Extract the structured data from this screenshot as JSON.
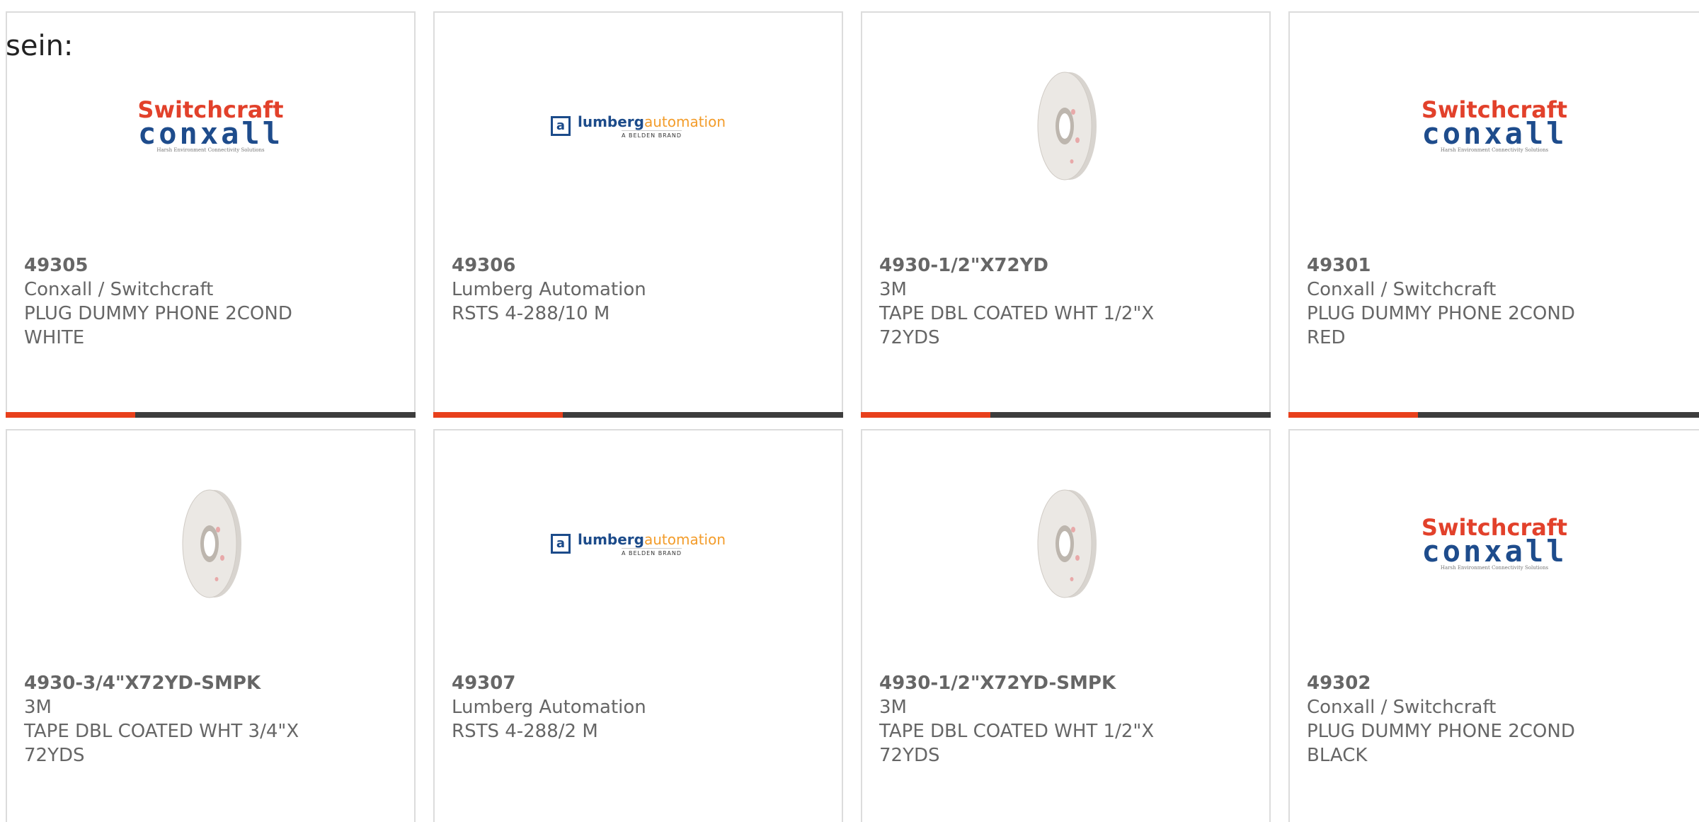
{
  "lead_text": "sein:",
  "colors": {
    "accent": "#e8401c",
    "bar_dark": "#3d3d3d",
    "text": "#666666",
    "border": "#dcdcdc"
  },
  "logos": {
    "switchcraft": {
      "line1": "Switchcraft",
      "line2": "conxall",
      "tagline": "Harsh Environment Connectivity Solutions"
    },
    "lumberg": {
      "box": "a",
      "main_bold": "lumberg",
      "main_light": "automation",
      "sub": "A BELDEN BRAND"
    }
  },
  "products": [
    {
      "part_number": "49305",
      "manufacturer": "Conxall / Switchcraft",
      "description": "PLUG DUMMY PHONE 2COND WHITE",
      "image": "switchcraft-logo"
    },
    {
      "part_number": "49306",
      "manufacturer": "Lumberg Automation",
      "description": "RSTS 4-288/10 M",
      "image": "lumberg-logo"
    },
    {
      "part_number": "4930-1/2\"X72YD",
      "manufacturer": "3M",
      "description": "TAPE DBL COATED WHT 1/2\"X 72YDS",
      "image": "tape-roll"
    },
    {
      "part_number": "49301",
      "manufacturer": "Conxall / Switchcraft",
      "description": "PLUG DUMMY PHONE 2COND RED",
      "image": "switchcraft-logo"
    },
    {
      "part_number": "4930-3/4\"X72YD-SMPK",
      "manufacturer": "3M",
      "description": "TAPE DBL COATED WHT 3/4\"X 72YDS",
      "image": "tape-roll"
    },
    {
      "part_number": "49307",
      "manufacturer": "Lumberg Automation",
      "description": "RSTS 4-288/2 M",
      "image": "lumberg-logo"
    },
    {
      "part_number": "4930-1/2\"X72YD-SMPK",
      "manufacturer": "3M",
      "description": "TAPE DBL COATED WHT 1/2\"X 72YDS",
      "image": "tape-roll"
    },
    {
      "part_number": "49302",
      "manufacturer": "Conxall / Switchcraft",
      "description": "PLUG DUMMY PHONE 2COND BLACK",
      "image": "switchcraft-logo"
    }
  ]
}
